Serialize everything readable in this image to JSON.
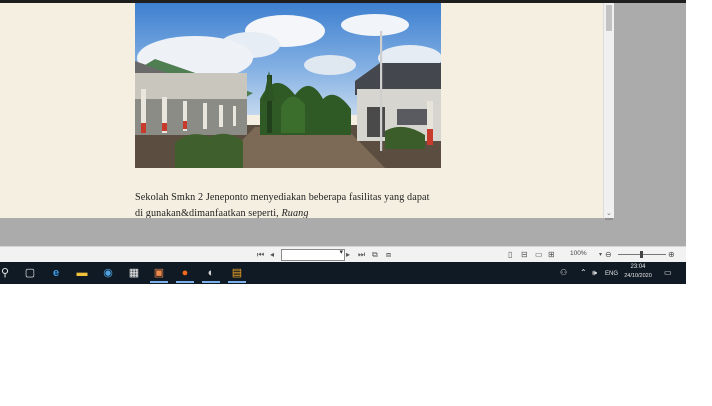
{
  "document": {
    "line1": "Sekolah Smkn 2 Jeneponto menyediakan beberapa fasilitas yang dapat",
    "line2_prefix": "di gunakan&dimanfaatkan seperti, ",
    "line2_italic": "Ruang"
  },
  "viewer": {
    "zoom": "100%",
    "page_value": ""
  },
  "taskbar": {
    "apps": [
      "search-icon",
      "task-view-icon",
      "edge-icon",
      "file-explorer-icon",
      "chrome-icon",
      "clapperboard-icon",
      "photo-app-icon",
      "firefox-icon",
      "media-app-icon",
      "archive-app-icon"
    ],
    "tray": {
      "language": "ENG",
      "time": "23:04",
      "date": "24/10/2020"
    }
  },
  "colors": {
    "page_background": "#f5efe1",
    "taskbar": "#101a25",
    "workspace": "#ababab"
  }
}
